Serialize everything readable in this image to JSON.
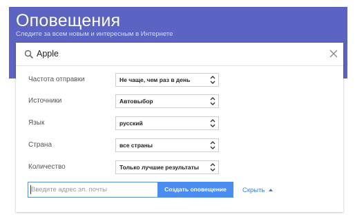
{
  "header": {
    "title": "Оповещения",
    "subtitle": "Следите за всем новым и интересным в Интернете"
  },
  "search": {
    "query": "Apple",
    "search_icon": "search-icon",
    "close_icon": "close-icon"
  },
  "options": [
    {
      "label": "Частота отправки",
      "value": "Не чаще, чем раз в день"
    },
    {
      "label": "Источники",
      "value": "Автовыбор"
    },
    {
      "label": "Язык",
      "value": "русский"
    },
    {
      "label": "Страна",
      "value": "все страны"
    },
    {
      "label": "Количество",
      "value": "Только лучшие результаты"
    }
  ],
  "footer": {
    "email_placeholder": "Введите адрес эл. почты",
    "create_label": "Создать оповещение",
    "hide_label": "Скрыть"
  },
  "colors": {
    "header_bg": "#5b64c2",
    "button_bg": "#4a8cf0",
    "link": "#3b7ee0"
  }
}
